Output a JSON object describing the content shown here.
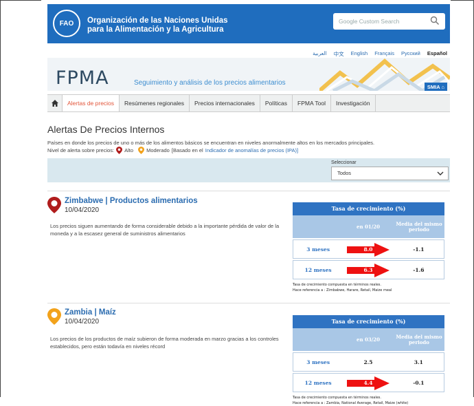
{
  "header": {
    "org_line1": "Organización de las Naciones Unidas",
    "org_line2": "para la Alimentación y la Agricultura",
    "logo_text": "FAO",
    "search_placeholder": "Google Custom Search"
  },
  "languages": [
    "العربية",
    "中文",
    "English",
    "Français",
    "Русский",
    "Español"
  ],
  "active_language": "Español",
  "banner": {
    "title": "FPMA",
    "subtitle": "Seguimiento y análisis de los precios alimentarios",
    "smia_label": "SMIA"
  },
  "nav": {
    "tabs": [
      "Alertas de precios",
      "Resúmenes regionales",
      "Precios internacionales",
      "Políticas",
      "FPMA Tool",
      "Investigación"
    ],
    "active": "Alertas de precios"
  },
  "main": {
    "title": "Alertas De Precios Internos",
    "description": "Países en donde los precios de uno o más de los alimentos básicos se encuentran en niveles anormalmente altos en los mercados principales.",
    "alert_level_label": "Nivel de alerta sobre precios:",
    "level_high": "Alto",
    "level_moderate": "Moderado",
    "based_on": "[Basado en el",
    "indicator_link": "Indicador de anomalías de precios (IPA)]",
    "filter_label": "Seleccionar",
    "filter_value": "Todos"
  },
  "alerts": [
    {
      "title": "Zimbabwe | Productos alimentarios",
      "date": "10/04/2020",
      "text": "Los precios siguen aumentando de forma considerable debido a la importante pérdida de valor de la moneda y a la escasez general de suministros alimentarios",
      "level": "high",
      "table_header": "Tasa de crecimiento  (%)",
      "col_period": "en 01/20",
      "col_avg": "Media del mismo periodo",
      "rows": [
        {
          "label": "3 meses",
          "value": "8.0",
          "avg": "-1.1",
          "arrow": true
        },
        {
          "label": "12 meses",
          "value": "6.3",
          "avg": "-1.6",
          "arrow": true
        }
      ],
      "note1": "Tasa de crecimiento compuesta en términos reales.",
      "note2": "Hace referencia a : Zimbabwe, Harare, Retail, Maize meal"
    },
    {
      "title": "Zambia | Maíz",
      "date": "10/04/2020",
      "text": "Los precios de los productos de maíz subieron de forma moderada en marzo gracias a los controles establecidos, pero están todavía en niveles récord",
      "level": "moderate",
      "table_header": "Tasa de crecimiento  (%)",
      "col_period": "en 03/20",
      "col_avg": "Media del mismo periodo",
      "rows": [
        {
          "label": "3 meses",
          "value": "2.5",
          "avg": "3.1",
          "arrow": false
        },
        {
          "label": "12 meses",
          "value": "4.4",
          "avg": "-0.1",
          "arrow": true
        }
      ],
      "note1": "Tasa de crecimiento compuesta en términos reales.",
      "note2": "Hace referencia a : Zambia, National Average, Retail, Maize (white)"
    }
  ],
  "colors": {
    "brand_blue": "#1f6dbe",
    "alert_high": "#b01c1c",
    "alert_moderate": "#f2a21b",
    "nav_active": "#e2553a"
  }
}
